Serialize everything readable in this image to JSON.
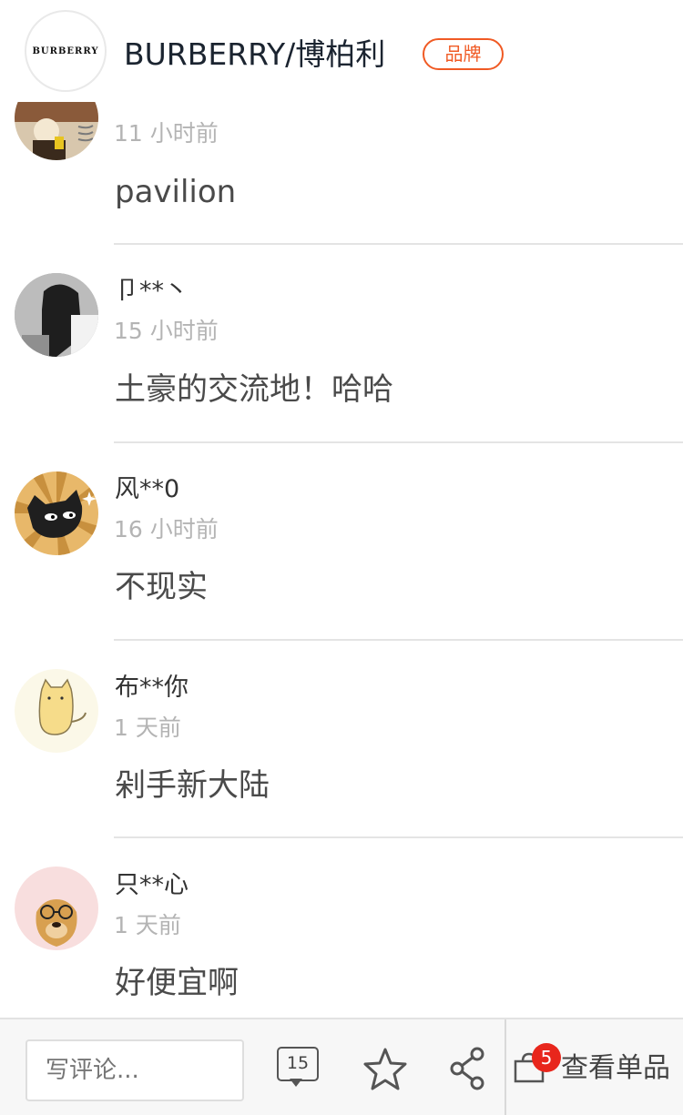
{
  "header": {
    "logo_text": "BURBERRY",
    "brand_name": "BURBERRY/博柏利",
    "badge": "品牌"
  },
  "comments": [
    {
      "user": "",
      "time": "11 小时前",
      "text": "pavilion",
      "avatar": "dessert-avatar"
    },
    {
      "user": "卩**丶",
      "time": "15 小时前",
      "text": "土豪的交流地！哈哈",
      "avatar": "woman-avatar"
    },
    {
      "user": "风**0",
      "time": "16 小时前",
      "text": "不现实",
      "avatar": "cat-cartoon-avatar"
    },
    {
      "user": "布**你",
      "time": "1 天前",
      "text": "剁手新大陆",
      "avatar": "cat-sketch-avatar"
    },
    {
      "user": "只**心",
      "time": "1 天前",
      "text": "好便宜啊",
      "avatar": "dog-glasses-avatar"
    }
  ],
  "bottom_bar": {
    "input_placeholder": "写评论...",
    "comment_count": "15",
    "cart_badge": "5",
    "view_item_label": "查看单品"
  },
  "colors": {
    "accent": "#f05a24",
    "badge_red": "#e8261c",
    "divider": "#e4e4e4",
    "time_gray": "#b4b4b4"
  }
}
